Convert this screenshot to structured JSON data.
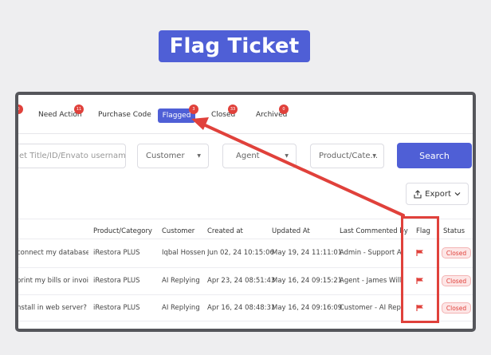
{
  "title": "Flag Ticket",
  "tabs": [
    {
      "label": "Need Action",
      "badge": "11"
    },
    {
      "label": "Purchase Code",
      "badge": ""
    },
    {
      "label": "Flagged",
      "badge": "3"
    },
    {
      "label": "Closed",
      "badge": "33"
    },
    {
      "label": "Archived",
      "badge": "0"
    }
  ],
  "first_badge": "0",
  "filters": {
    "search_placeholder": "et Title/ID/Envato username",
    "customer": "Customer",
    "agent": "Agent",
    "product": "Product/Cate...",
    "search_button": "Search"
  },
  "export_label": "Export",
  "columns": [
    "Product/Category",
    "Customer",
    "Created at",
    "Updated At",
    "Last Commented by",
    "Flag",
    "Status"
  ],
  "rows": [
    {
      "subject": "connect my database?",
      "product": "iRestora PLUS",
      "customer": "Iqbal Hossen",
      "created": "Jun 02, 24 10:15:06",
      "updated": "May 19, 24 11:11:01",
      "last_commented": "Admin - Support Admin",
      "status": "Closed"
    },
    {
      "subject": "print my bills or invoi",
      "product": "iRestora PLUS",
      "customer": "AI Replying",
      "created": "Apr 23, 24 08:51:43",
      "updated": "May 16, 24 09:15:21",
      "last_commented": "Agent - James William",
      "status": "Closed"
    },
    {
      "subject": "nstall in web server?",
      "product": "iRestora PLUS",
      "customer": "AI Replying",
      "created": "Apr 16, 24 08:48:31",
      "updated": "May 16, 24 09:16:09",
      "last_commented": "Customer - AI Replying",
      "status": "Closed"
    }
  ],
  "colors": {
    "accent": "#4f5fd6",
    "annotation": "#e0413b",
    "flag": "#e0413b"
  }
}
